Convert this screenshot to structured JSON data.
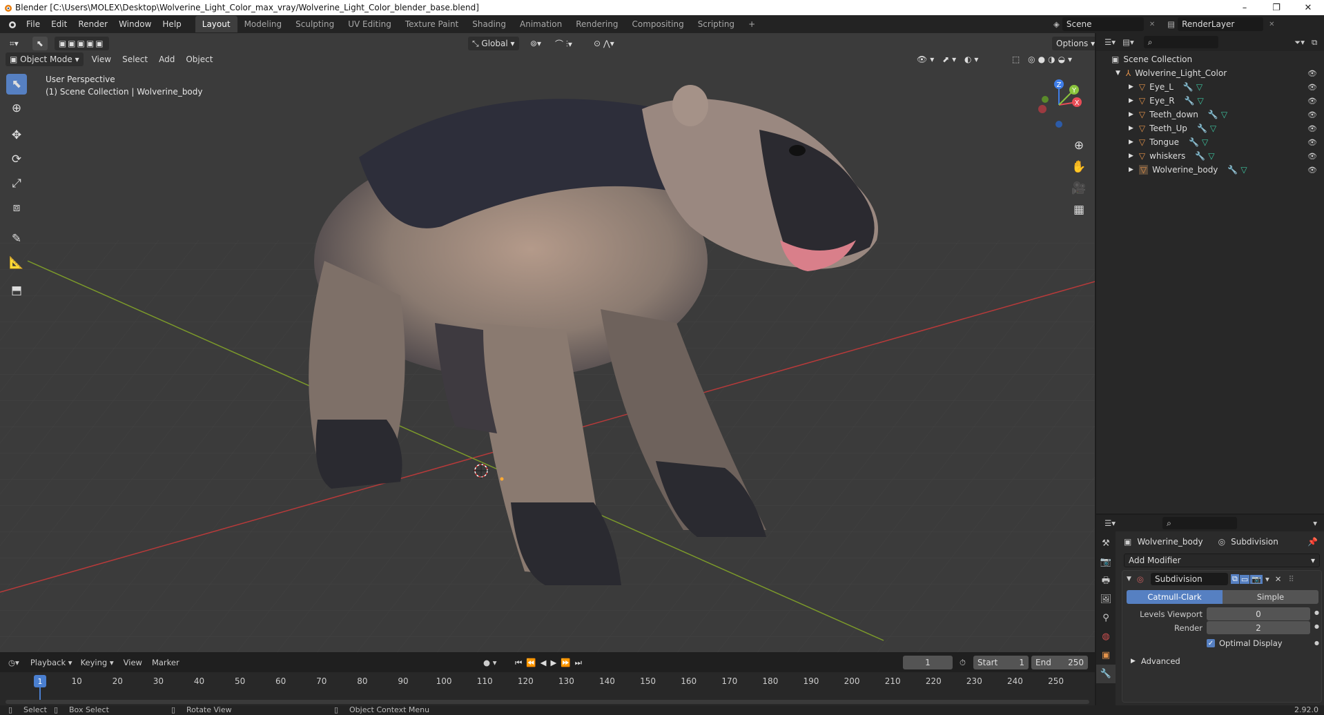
{
  "window": {
    "title": "Blender [C:\\Users\\MOLEX\\Desktop\\Wolverine_Light_Color_max_vray/Wolverine_Light_Color_blender_base.blend]",
    "minimize": "–",
    "maximize": "❐",
    "close": "✕"
  },
  "menu": [
    "File",
    "Edit",
    "Render",
    "Window",
    "Help"
  ],
  "workspaces": [
    "Layout",
    "Modeling",
    "Sculpting",
    "UV Editing",
    "Texture Paint",
    "Shading",
    "Animation",
    "Rendering",
    "Compositing",
    "Scripting"
  ],
  "workspace_add": "+",
  "scene": {
    "name": "Scene",
    "render_layer": "RenderLayer"
  },
  "viewport_header": {
    "mode": "Object Mode",
    "menus": [
      "View",
      "Select",
      "Add",
      "Object"
    ],
    "transform_orientation": "Global",
    "options": "Options"
  },
  "viewport": {
    "perspective": "User Perspective",
    "collection": "(1) Scene Collection | Wolverine_body",
    "gizmo": {
      "z": "Z",
      "y": "Y",
      "x": "X"
    }
  },
  "outliner": {
    "root": "Scene Collection",
    "collection": "Wolverine_Light_Color",
    "objects": [
      "Eye_L",
      "Eye_R",
      "Teeth_down",
      "Teeth_Up",
      "Tongue",
      "whiskers",
      "Wolverine_body"
    ]
  },
  "properties": {
    "object": "Wolverine_body",
    "modifier_context": "Subdivision",
    "add_modifier": "Add Modifier",
    "modifier_name": "Subdivision",
    "type_options": [
      "Catmull-Clark",
      "Simple"
    ],
    "active_type": "Catmull-Clark",
    "levels_label": "Levels Viewport",
    "levels_value": "0",
    "render_label": "Render",
    "render_value": "2",
    "optimal_display": "Optimal Display",
    "advanced": "Advanced"
  },
  "timeline": {
    "menus": [
      "Playback",
      "Keying",
      "View",
      "Marker"
    ],
    "current_frame": "1",
    "start_label": "Start",
    "start": "1",
    "end_label": "End",
    "end": "250",
    "ticks": [
      "1",
      "10",
      "20",
      "30",
      "40",
      "50",
      "60",
      "70",
      "80",
      "90",
      "100",
      "110",
      "120",
      "130",
      "140",
      "150",
      "160",
      "170",
      "180",
      "190",
      "200",
      "210",
      "220",
      "230",
      "240",
      "250"
    ]
  },
  "status_bar": {
    "select": "Select",
    "box_select": "Box Select",
    "rotate": "Rotate View",
    "context_menu": "Object Context Menu",
    "version": "2.92.0"
  },
  "colors": {
    "accent": "#5680c2",
    "grid_x": "#b83a3a",
    "grid_y": "#7c9a2a",
    "object_orange": "#e3924a"
  }
}
